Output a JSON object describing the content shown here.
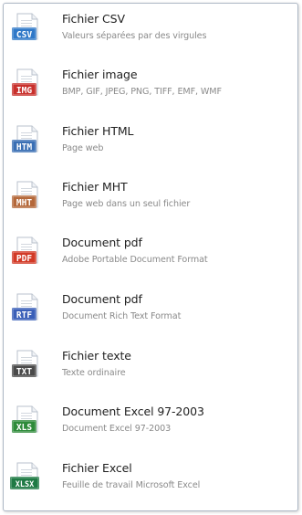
{
  "items": [
    {
      "title": "Fichier CSV",
      "desc": "Valeurs séparées par des virgules",
      "icon": "csv-icon",
      "badge": "CSV",
      "color": "#2f78c8"
    },
    {
      "title": "Fichier image",
      "desc": "BMP, GIF, JPEG, PNG, TIFF, EMF, WMF",
      "icon": "image-file-icon",
      "badge": "IMG",
      "color": "#c8302c"
    },
    {
      "title": "Fichier HTML",
      "desc": "Page web",
      "icon": "html-file-icon",
      "badge": "HTM",
      "color": "#3a6fb4"
    },
    {
      "title": "Fichier MHT",
      "desc": "Page web dans un seul fichier",
      "icon": "mht-file-icon",
      "badge": "MHT",
      "color": "#b4683a"
    },
    {
      "title": "Document pdf",
      "desc": "Adobe Portable Document Format",
      "icon": "pdf-file-icon",
      "badge": "PDF",
      "color": "#d23a26"
    },
    {
      "title": "Document pdf",
      "desc": "Document Rich Text Format",
      "icon": "rtf-file-icon",
      "badge": "RTF",
      "color": "#3a5fb8"
    },
    {
      "title": "Fichier texte",
      "desc": "Texte ordinaire",
      "icon": "txt-file-icon",
      "badge": "TXT",
      "color": "#4a4a4a"
    },
    {
      "title": "Document Excel 97-2003",
      "desc": "Document Excel 97-2003",
      "icon": "xls-file-icon",
      "badge": "XLS",
      "color": "#2e8b3a"
    },
    {
      "title": "Fichier Excel",
      "desc": "Feuille de travail Microsoft Excel",
      "icon": "xlsx-file-icon",
      "badge": "XLSX",
      "color": "#1f7a44"
    }
  ]
}
